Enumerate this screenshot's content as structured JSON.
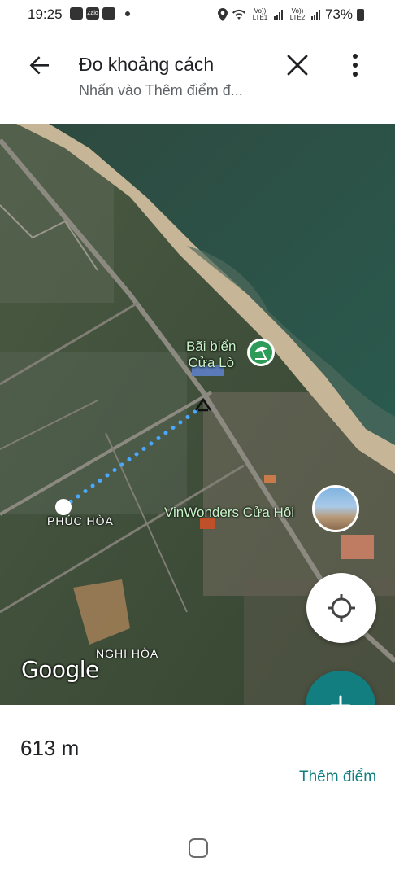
{
  "status_bar": {
    "time": "19:25",
    "notif_zalo": "Zalo",
    "sim1": "Vo)) LTE1",
    "sim2": "Vo)) LTE2",
    "battery": "73%"
  },
  "header": {
    "title": "Đo khoảng cách",
    "subtitle": "Nhấn vào Thêm điểm đ..."
  },
  "map": {
    "labels": {
      "beach_line1": "Bãi biển",
      "beach_line2": "Cửa Lò",
      "vinwonders": "VinWonders Cửa Hội",
      "phuc_hoa": "PHÚC HÒA",
      "nghi_hoa": "NGHI HÒA",
      "google": "Google"
    },
    "icons": {
      "beach": "beach-umbrella-icon",
      "locate": "my-location-icon",
      "add": "plus-icon"
    },
    "colors": {
      "sea": "#2d5046",
      "sand": "#c8b99a",
      "measure_line": "#4aa8ff",
      "accent": "#127e80"
    }
  },
  "panel": {
    "distance": "613 m",
    "add_point": "Thêm điểm"
  }
}
